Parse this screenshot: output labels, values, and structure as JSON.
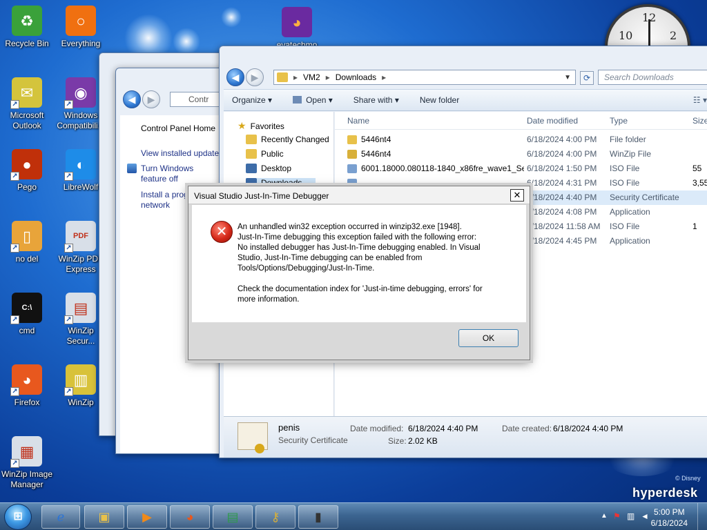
{
  "desktop": {
    "icons": [
      {
        "label": "Recycle Bin",
        "glyph": "♻",
        "color": "#3aa13a"
      },
      {
        "label": "Everything",
        "glyph": "○",
        "color": "#f07010"
      },
      {
        "label": "Microsoft Outlook",
        "glyph": "✉",
        "color": "#d4c43c"
      },
      {
        "label": "Windows Compatibili...",
        "glyph": "◉",
        "color": "#7a3aa8"
      },
      {
        "label": "Pego",
        "glyph": "●",
        "color": "#c0300a"
      },
      {
        "label": "LibreWolf",
        "glyph": "◐",
        "color": "#1e8ce8"
      },
      {
        "label": "no del",
        "glyph": "▯",
        "color": "#e8a43a"
      },
      {
        "label": "WinZip PDF Express",
        "glyph": "PDF",
        "color": "#d8dfe8"
      },
      {
        "label": "cmd",
        "glyph": "C:\\",
        "color": "#111111"
      },
      {
        "label": "WinZip Secur...",
        "glyph": "▤",
        "color": "#d8dfe8"
      },
      {
        "label": "Firefox",
        "glyph": "◕",
        "color": "#e8581e"
      },
      {
        "label": "WinZip",
        "glyph": "▥",
        "color": "#d8c23a"
      },
      {
        "label": "WinZip Image Manager",
        "glyph": "▦",
        "color": "#d8dfe8"
      }
    ],
    "top_icon_label": "evatechmo",
    "brand": "hyperdesk",
    "disney": "© Disney"
  },
  "clock": {
    "n12": "12",
    "n10": "10",
    "n2": "2"
  },
  "control_panel": {
    "address": "Contr",
    "home": "Control Panel Home",
    "links": [
      "View installed update",
      "Turn Windows feature off",
      "Install a prog network"
    ]
  },
  "explorer": {
    "path": [
      "VM2",
      "Downloads"
    ],
    "search_placeholder": "Search Downloads",
    "toolbar": {
      "organize": "Organize",
      "open": "Open",
      "share": "Share with",
      "new_folder": "New folder"
    },
    "nav": [
      "Favorites",
      "Recently Changed",
      "Public",
      "Desktop",
      "Downloads"
    ],
    "columns": {
      "name": "Name",
      "date": "Date modified",
      "type": "Type",
      "size": "Size"
    },
    "rows": [
      {
        "name": "5446nt4",
        "date": "6/18/2024 4:00 PM",
        "type": "File folder",
        "size": "",
        "icon": "#e8c14a"
      },
      {
        "name": "5446nt4",
        "date": "6/18/2024 4:00 PM",
        "type": "WinZip File",
        "size": "",
        "icon": "#d8b03a"
      },
      {
        "name": "6001.18000.080118-1840_x86fre_wave1_Se...",
        "date": "6/18/2024 1:50 PM",
        "type": "ISO File",
        "size": "55",
        "icon": "#7aa0d0"
      },
      {
        "name": "",
        "date": "6/18/2024 4:31 PM",
        "type": "ISO File",
        "size": "3,55",
        "icon": "#7aa0d0"
      },
      {
        "name": "",
        "date": "6/18/2024 4:40 PM",
        "type": "Security Certificate",
        "size": "",
        "icon": "#c9b27a"
      },
      {
        "name": "",
        "date": "6/18/2024 4:08 PM",
        "type": "Application",
        "size": "",
        "icon": "#8ab"
      },
      {
        "name": "",
        "date": "6/18/2024 11:58 AM",
        "type": "ISO File",
        "size": "1",
        "icon": "#7aa0d0"
      },
      {
        "name": "",
        "date": "6/18/2024 4:45 PM",
        "type": "Application",
        "size": "",
        "icon": "#8ab"
      }
    ],
    "details": {
      "filename": "penis",
      "filetype": "Security Certificate",
      "modified_label": "Date modified:",
      "modified": "6/18/2024 4:40 PM",
      "size_label": "Size:",
      "size": "2.02 KB",
      "created_label": "Date created:",
      "created": "6/18/2024 4:40 PM"
    }
  },
  "dialog": {
    "title": "Visual Studio Just-In-Time Debugger",
    "close": "✕",
    "message_lines": [
      "An unhandled win32 exception occurred in winzip32.exe [1948].",
      "Just-In-Time debugging this exception failed with the following error:",
      "No installed debugger has Just-In-Time debugging enabled. In Visual",
      "Studio, Just-In-Time debugging can be enabled from",
      "Tools/Options/Debugging/Just-In-Time."
    ],
    "message2_lines": [
      "Check the documentation index for 'Just-in-time debugging, errors' for",
      "more information."
    ],
    "ok": "OK"
  },
  "taskbar": {
    "time": "5:00 PM",
    "date": "6/18/2024",
    "buttons": [
      "ie-icon",
      "explorer-icon",
      "media-player-icon",
      "firefox-icon",
      "control-panel-icon",
      "keys-icon",
      "terminal-icon"
    ]
  }
}
